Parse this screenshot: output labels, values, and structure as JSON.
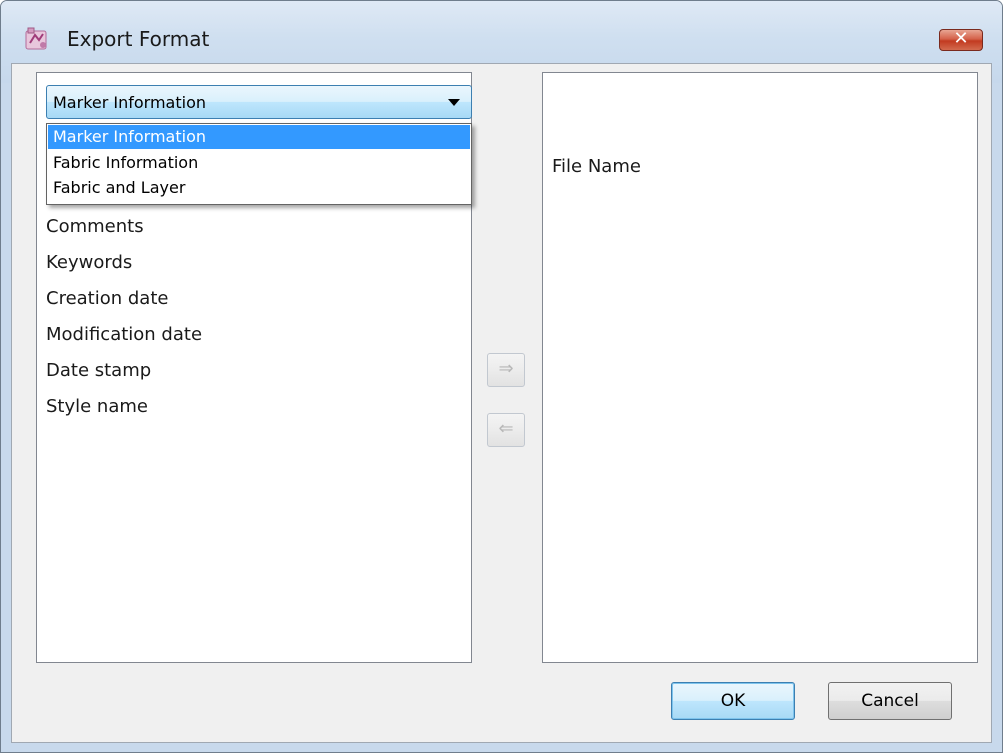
{
  "window": {
    "title": "Export Format",
    "close_label": "✕"
  },
  "combo": {
    "selected": "Marker Information",
    "options": [
      "Marker Information",
      "Fabric Information",
      "Fabric and Layer"
    ]
  },
  "left_list": {
    "items": [
      "Comments",
      "Keywords",
      "Creation date",
      "Modification date",
      "Date stamp",
      "Style name"
    ]
  },
  "right_list": {
    "items": [
      "File Name"
    ]
  },
  "transfer": {
    "add_icon": "⇒",
    "remove_icon": "⇐"
  },
  "buttons": {
    "ok": "OK",
    "cancel": "Cancel"
  }
}
